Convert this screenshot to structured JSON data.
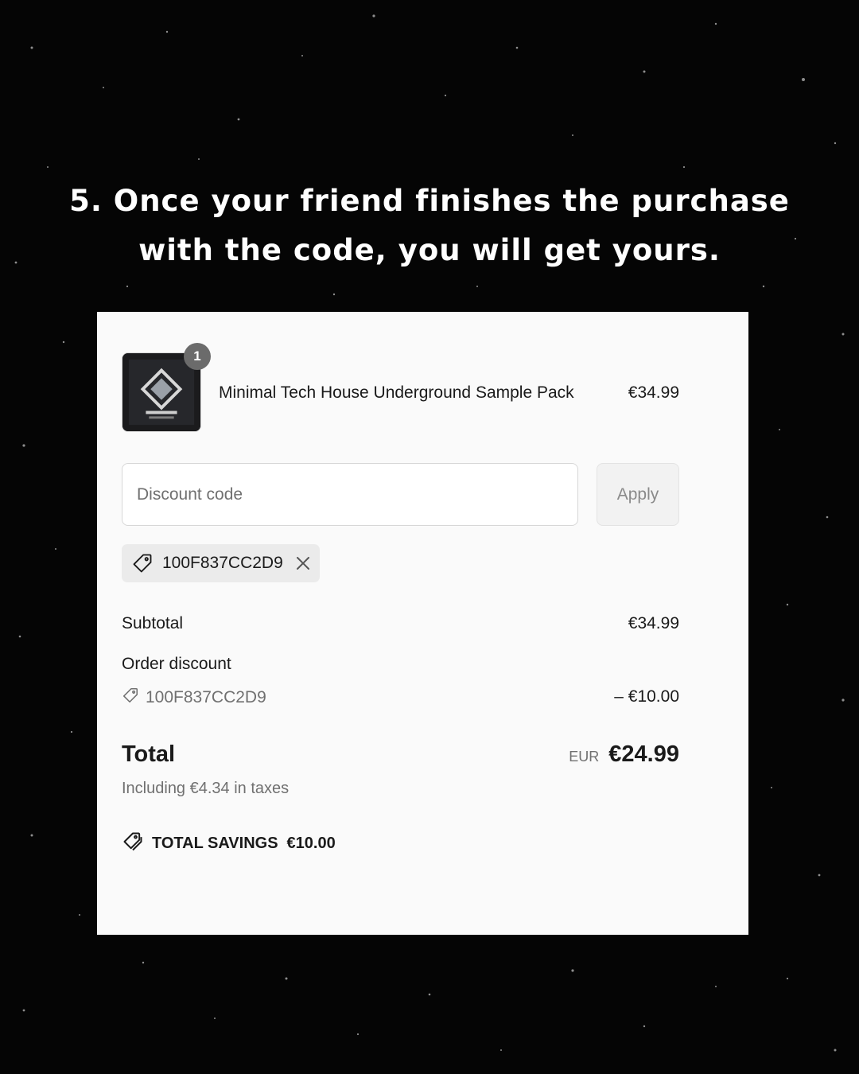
{
  "headline": {
    "line1": "5. Once your friend finishes the purchase",
    "line2": "with the code, you will get yours."
  },
  "product": {
    "name": "Minimal Tech House Underground Sample Pack",
    "price": "€34.99",
    "quantity": "1",
    "thumbnail_icon": "sample-pack-box-image"
  },
  "discount": {
    "placeholder": "Discount code",
    "apply_label": "Apply",
    "applied_code": "100F837CC2D9"
  },
  "summary": {
    "subtotal_label": "Subtotal",
    "subtotal_value": "€34.99",
    "order_discount_label": "Order discount",
    "order_discount_code": "100F837CC2D9",
    "order_discount_value": "– €10.00",
    "total_label": "Total",
    "total_currency": "EUR",
    "total_value": "€24.99",
    "tax_note": "Including €4.34 in taxes",
    "savings_label": "TOTAL SAVINGS",
    "savings_value": "€10.00"
  },
  "colors": {
    "background": "#050505",
    "card": "#fafafa",
    "text": "#1a1a1a",
    "muted": "#707070"
  }
}
